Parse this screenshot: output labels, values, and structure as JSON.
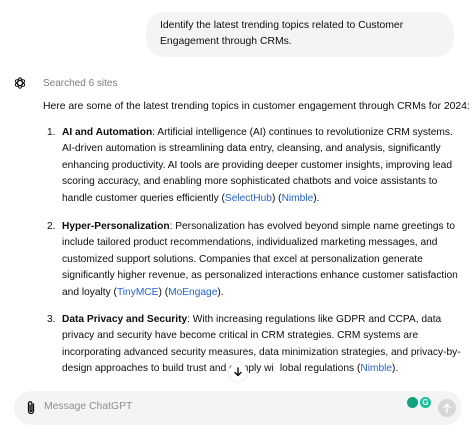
{
  "user_message": "Identify the latest trending topics related to Customer Engagement through CRMs.",
  "assistant": {
    "searched_label": "Searched 6 sites",
    "intro": "Here are some of the latest trending topics in customer engagement through CRMs for 2024:",
    "items": [
      {
        "number": "1.",
        "title": "AI and Automation",
        "text": ": Artificial intelligence (AI) continues to revolutionize CRM systems. AI-driven automation is streamlining data entry, cleansing, and analysis, significantly enhancing productivity. AI tools are providing deeper customer insights, improving lead scoring accuracy, and enabling more sophisticated chatbots and voice assistants to handle customer queries efficiently ",
        "links": [
          "SelectHub",
          "Nimble"
        ],
        "tail": "."
      },
      {
        "number": "2.",
        "title": "Hyper-Personalization",
        "text": ": Personalization has evolved beyond simple name greetings to include tailored product recommendations, individualized marketing messages, and customized support solutions. Companies that excel at personalization generate significantly higher revenue, as personalized interactions enhance customer satisfaction and loyalty ",
        "links": [
          "TinyMCE",
          "MoEngage"
        ],
        "tail": "."
      },
      {
        "number": "3.",
        "title": "Data Privacy and Security",
        "text": ": With increasing regulations like GDPR and CCPA, data privacy and security have become critical in CRM strategies. CRM systems are incorporating advanced security measures, data minimization strategies, and privacy-by-design approaches to build trust and comply wi   lobal regulations ",
        "links": [
          "Nimble"
        ],
        "tail": "."
      }
    ]
  },
  "composer": {
    "placeholder": "Message ChatGPT",
    "extension_b_letter": "G"
  },
  "icons": {
    "assistant": "openai-logo-icon",
    "scroll": "arrow-down-icon",
    "attach": "paperclip-icon",
    "send": "arrow-up-icon"
  },
  "colors": {
    "link": "#2564cf",
    "bubble": "#f4f4f4",
    "muted": "#7d7d7d"
  }
}
